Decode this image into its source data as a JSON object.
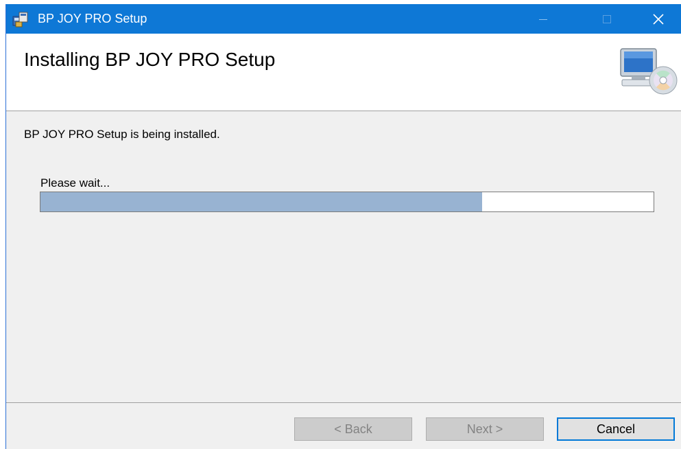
{
  "window": {
    "title": "BP JOY PRO Setup",
    "icons": {
      "app": "installer-icon",
      "minimize": "minimize-icon",
      "maximize": "maximize-icon",
      "close": "close-icon"
    }
  },
  "header": {
    "heading": "Installing BP JOY PRO Setup",
    "icon": "computer-cd-icon"
  },
  "body": {
    "status_text": "BP JOY PRO Setup is being installed.",
    "wait_text": "Please wait...",
    "progress": 0.72
  },
  "buttons": {
    "back": "< Back",
    "next": "Next >",
    "cancel": "Cancel"
  },
  "colors": {
    "titlebar": "#0e78d6",
    "progress_fill": "#98b3d2",
    "focus_border": "#0078d7"
  }
}
